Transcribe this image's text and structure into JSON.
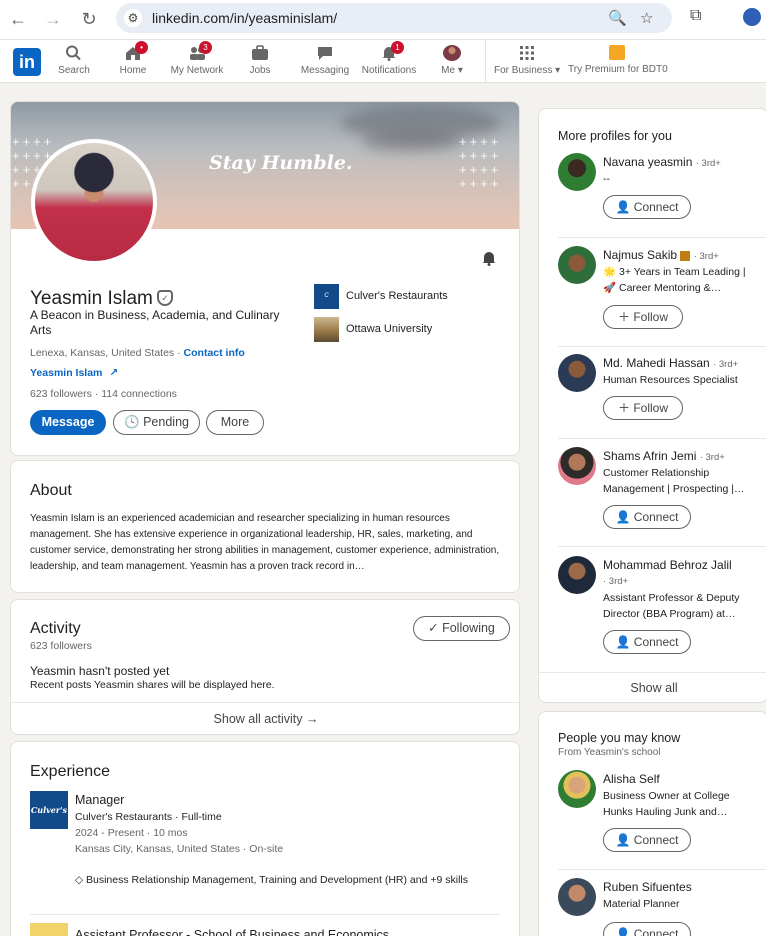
{
  "browser": {
    "url": "linkedin.com/in/yeasminislam/"
  },
  "linkedin_nav": {
    "logo_text": "in",
    "items": [
      {
        "label": "Search"
      },
      {
        "label": "Home",
        "badge": "•"
      },
      {
        "label": "My Network",
        "badge": "3"
      },
      {
        "label": "Jobs"
      },
      {
        "label": "Messaging"
      },
      {
        "label": "Notifications",
        "badge": "1"
      },
      {
        "label": "Me"
      },
      {
        "label": "For Business"
      },
      {
        "label": "Try Premium for BDT0"
      }
    ]
  },
  "profile": {
    "banner_slogan": "Stay Humble.",
    "name": "Yeasmin Islam",
    "headline": "A Beacon in Business, Academia, and Culinary Arts",
    "location": "Lenexa, Kansas, United States",
    "contact_link": "Contact info",
    "website": "Yeasmin Islam",
    "followers": "623 followers",
    "connections": "114 connections",
    "buttons": {
      "message": "Message",
      "pending": "Pending",
      "more": "More"
    },
    "orgs": [
      {
        "name": "Culver's Restaurants"
      },
      {
        "name": "Ottawa University"
      }
    ]
  },
  "about": {
    "title": "About",
    "text": "Yeasmin Islam is an experienced academician and researcher specializing in human resources management. She has extensive experience in organizational leadership, HR, sales, marketing, and customer service, demonstrating her strong abilities in management, customer experience, administration, leadership, and team management. Yeasmin has a proven track record in…"
  },
  "activity": {
    "title": "Activity",
    "followers": "623 followers",
    "following_button": "Following",
    "empty_title": "Yeasmin hasn't posted yet",
    "empty_sub": "Recent posts Yeasmin shares will be displayed here.",
    "show_all": "Show all activity →"
  },
  "experience": {
    "title": "Experience",
    "items": [
      {
        "role": "Manager",
        "company": "Culver's Restaurants · Full-time",
        "dates": "2024 - Present · 10 mos",
        "location": "Kansas City, Kansas, United States · On-site",
        "skills": "Business Relationship Management, Training and Development (HR) and +9 skills",
        "logo_text": "Culver's"
      },
      {
        "role": "Assistant Professor - School of Business and Economics"
      }
    ]
  },
  "more_profiles": {
    "title": "More profiles for you",
    "people": [
      {
        "name": "Navana yeasmin",
        "degree": "· 3rd+",
        "sub": "--",
        "action": "Connect"
      },
      {
        "name": "Najmus Sakib",
        "degree": "· 3rd+",
        "sub": "🌟 3+ Years in Team Leading | 🚀 Career Mentoring &…",
        "action": "Follow"
      },
      {
        "name": "Md. Mahedi Hassan",
        "degree": "· 3rd+",
        "sub": "Human Resources Specialist",
        "action": "Follow"
      },
      {
        "name": "Shams Afrin Jemi",
        "degree": "· 3rd+",
        "sub": "Customer Relationship Management | Prospecting |…",
        "action": "Connect"
      },
      {
        "name": "Mohammad Behroz Jalil",
        "degree": "· 3rd+",
        "sub": "Assistant Professor & Deputy Director (BBA Program) at…",
        "action": "Connect"
      }
    ],
    "show_all": "Show all"
  },
  "people_may_know": {
    "title": "People you may know",
    "subtitle": "From Yeasmin's school",
    "people": [
      {
        "name": "Alisha Self",
        "sub": "Business Owner at College Hunks Hauling Junk and…",
        "action": "Connect"
      },
      {
        "name": "Ruben Sifuentes",
        "sub": "Material Planner",
        "action": "Connect"
      }
    ]
  }
}
